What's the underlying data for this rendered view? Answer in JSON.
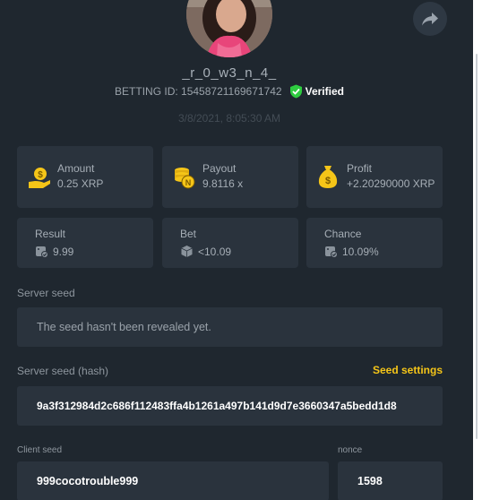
{
  "profile": {
    "username": "_r_0_w3_n_4_",
    "betting_id": "BETTING ID: 15458721169671742",
    "verified_label": "Verified",
    "timestamp": "3/8/2021, 8:05:30 AM"
  },
  "stats": [
    {
      "label": "Amount",
      "value": "0.25 XRP",
      "icon": "money-hand-icon"
    },
    {
      "label": "Payout",
      "value": "9.8116 x",
      "icon": "coin-stack-icon"
    },
    {
      "label": "Profit",
      "value": "+2.20290000 XRP",
      "icon": "money-bag-icon"
    },
    {
      "label": "Result",
      "value": "9.99",
      "icon": "dice-check-icon"
    },
    {
      "label": "Bet",
      "value": "<10.09",
      "icon": "dice-icon"
    },
    {
      "label": "Chance",
      "value": "10.09%",
      "icon": "dice-check-icon"
    }
  ],
  "server_seed": {
    "label": "Server seed",
    "value": "The seed hasn't been revealed yet."
  },
  "server_seed_hash": {
    "label": "Server seed (hash)",
    "value": "9a3f312984d2c686f112483ffa4b1261a497b141d9d7e3660347a5bedd1d8",
    "settings_label": "Seed settings"
  },
  "client_seed": {
    "label": "Client seed",
    "value": "999cocotrouble999"
  },
  "nonce": {
    "label": "nonce",
    "value": "1598"
  },
  "colors": {
    "background": "#1f272f",
    "card": "#2a333d",
    "accent_yellow": "#f5c518",
    "verified_green": "#2ecc40"
  }
}
